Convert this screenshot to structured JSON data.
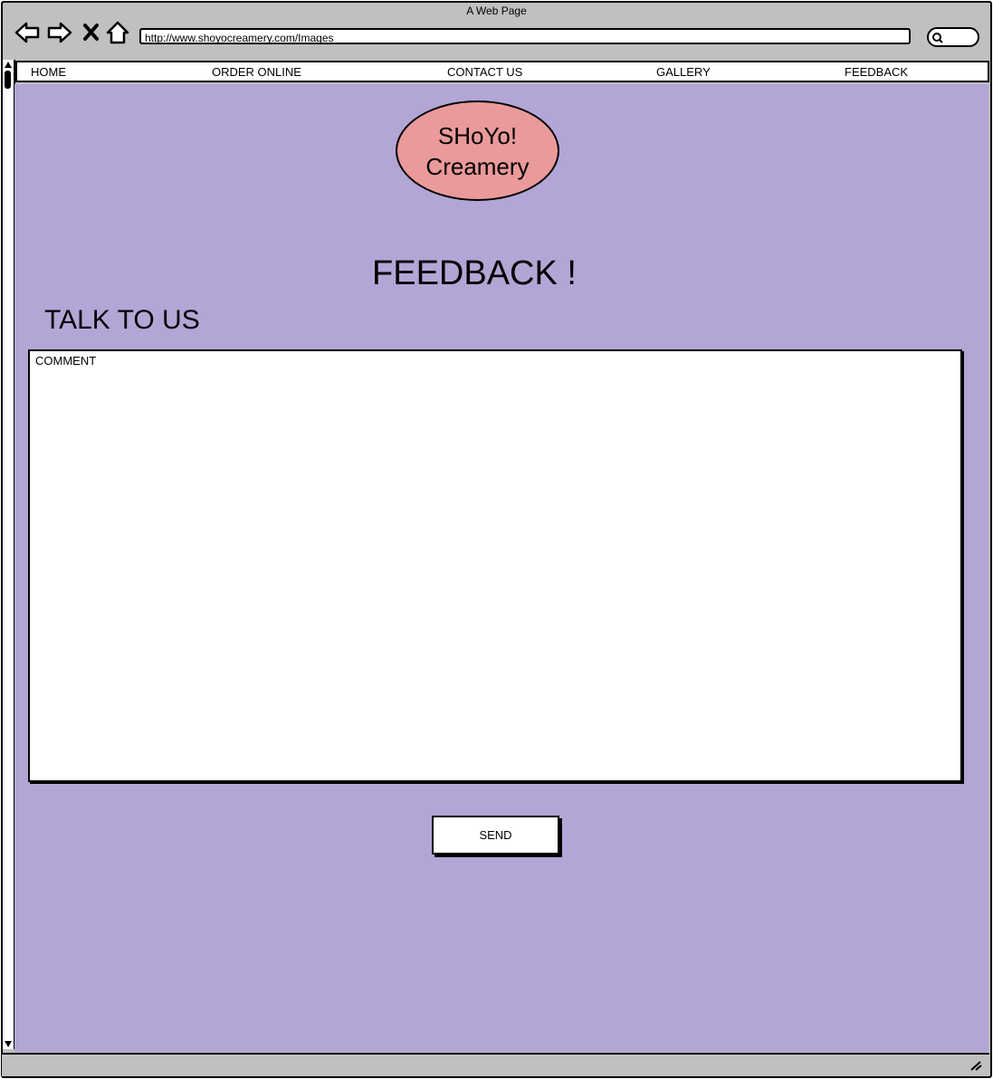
{
  "window": {
    "title": "A Web Page"
  },
  "browser": {
    "url": "http://www.shoyocreamery.com/Images",
    "icons": [
      "back-arrow-icon",
      "forward-arrow-icon",
      "close-icon",
      "home-icon",
      "search-icon"
    ]
  },
  "nav": {
    "items": [
      {
        "label": "HOME"
      },
      {
        "label": "ORDER ONLINE"
      },
      {
        "label": "CONTACT US"
      },
      {
        "label": "GALLERY"
      },
      {
        "label": "FEEDBACK"
      }
    ]
  },
  "logo": {
    "line1": "SHoYo!",
    "line2": "Creamery"
  },
  "page": {
    "heading": "FEEDBACK !",
    "subheading": "TALK TO US",
    "comment_placeholder": "COMMENT",
    "send_label": "SEND"
  },
  "colors": {
    "background": "#b3a6d6",
    "logo_fill": "#ea9a9a",
    "chrome": "#c0c0c0"
  }
}
